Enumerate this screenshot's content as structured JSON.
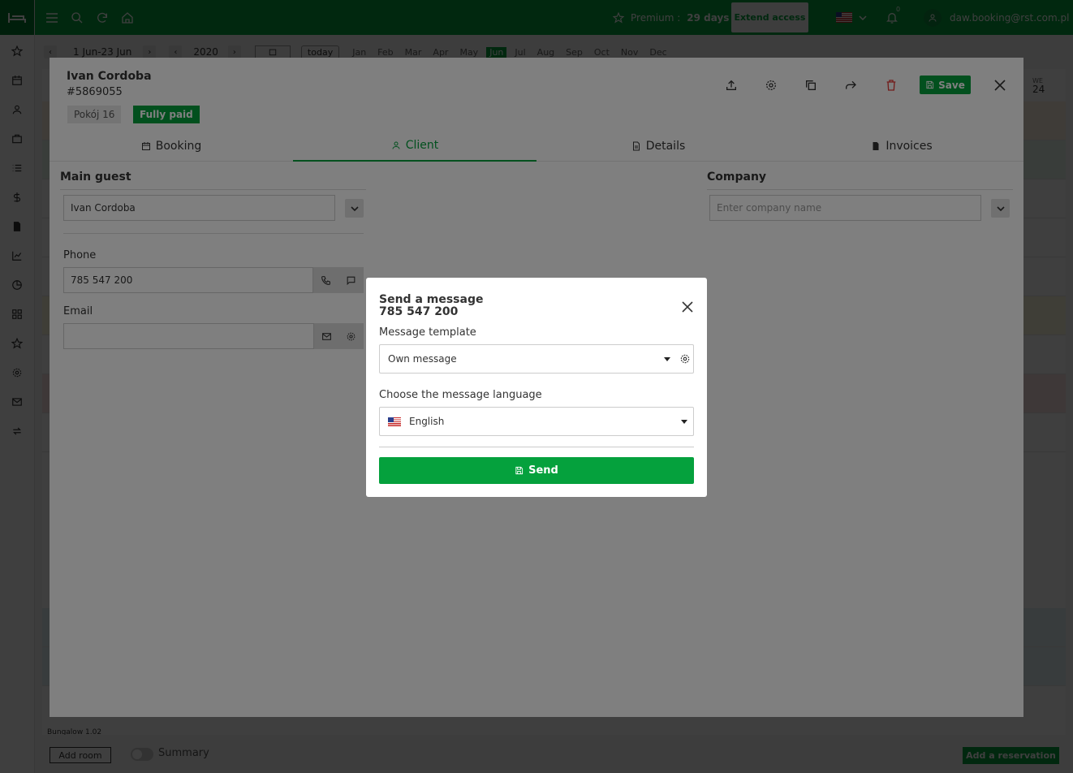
{
  "topbar": {
    "premium_label": "Premium :",
    "premium_days": "29 days",
    "extend_label": "Extend access",
    "notifications_count": "0",
    "user_email": "daw.booking@rst.com.pl"
  },
  "calendar_bar": {
    "range": "1 Jun-23 Jun",
    "year": "2020",
    "today_label": "today",
    "months": [
      "Jan",
      "Feb",
      "Mar",
      "Apr",
      "May",
      "Jun",
      "Jul",
      "Aug",
      "Sep",
      "Oct",
      "Nov",
      "Dec"
    ],
    "active_month": "Jun",
    "weekday_short": "WE",
    "day_number": "24"
  },
  "bottombar": {
    "add_room": "Add room",
    "summary": "Summary",
    "add_reservation": "Add a reservation"
  },
  "calendar_rows": {
    "last_room_name": "Bungalow 1.02"
  },
  "booking": {
    "guest_name": "Ivan Cordoba",
    "booking_id": "#5869055",
    "room": "Pokój 16",
    "payment_status": "Fully paid",
    "save_label": "Save",
    "tabs": [
      {
        "label": "Booking",
        "icon": "calendar-icon"
      },
      {
        "label": "Client",
        "icon": "user-icon"
      },
      {
        "label": "Details",
        "icon": "document-icon"
      },
      {
        "label": "Invoices",
        "icon": "invoice-icon"
      }
    ],
    "active_tab": "Client",
    "main_guest": {
      "title": "Main guest",
      "value": "Ivan Cordoba"
    },
    "phone": {
      "label": "Phone",
      "value": "785 547 200"
    },
    "email": {
      "label": "Email",
      "value": ""
    },
    "company": {
      "title": "Company",
      "placeholder": "Enter company name"
    }
  },
  "send_message": {
    "title": "Send a message",
    "phone": "785 547 200",
    "template_label": "Message template",
    "template_value": "Own message",
    "language_label": "Choose the message language",
    "language_value": "English",
    "send_label": "Send"
  },
  "colors": {
    "brand_green": "#05a13d",
    "dark_green": "#027a2f",
    "delete_red": "#e53935"
  }
}
